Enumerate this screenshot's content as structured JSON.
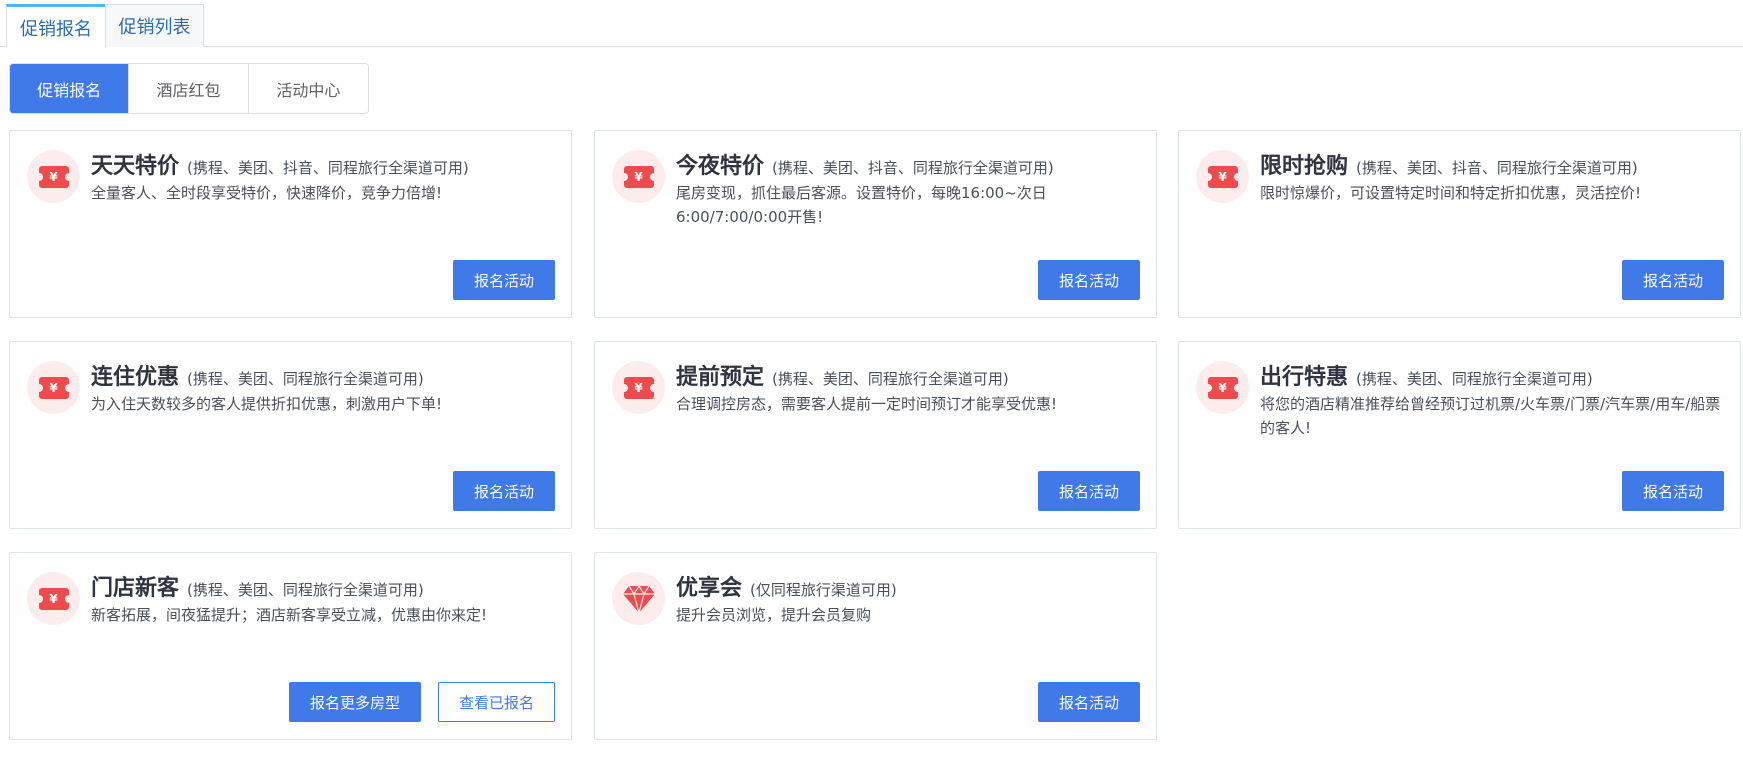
{
  "top_tabs": [
    "促销报名",
    "促销列表"
  ],
  "sub_tabs": [
    "促销报名",
    "酒店红包",
    "活动中心"
  ],
  "ticket_symbol": "¥",
  "cards": [
    {
      "title": "天天特价",
      "subtitle": "(携程、美团、抖音、同程旅行全渠道可用)",
      "desc": "全量客人、全时段享受特价，快速降价，竞争力倍增!",
      "button": "报名活动",
      "icon": "ticket-icon"
    },
    {
      "title": "今夜特价",
      "subtitle": "(携程、美团、抖音、同程旅行全渠道可用)",
      "desc": "尾房变现，抓住最后客源。设置特价，每晚16:00~次日6:00/7:00/0:00开售!",
      "button": "报名活动",
      "icon": "ticket-icon"
    },
    {
      "title": "限时抢购",
      "subtitle": "(携程、美团、抖音、同程旅行全渠道可用)",
      "desc": "限时惊爆价，可设置特定时间和特定折扣优惠，灵活控价!",
      "button": "报名活动",
      "icon": "ticket-icon"
    },
    {
      "title": "连住优惠",
      "subtitle": "(携程、美团、同程旅行全渠道可用)",
      "desc": "为入住天数较多的客人提供折扣优惠，刺激用户下单!",
      "button": "报名活动",
      "icon": "ticket-icon"
    },
    {
      "title": "提前预定",
      "subtitle": "(携程、美团、同程旅行全渠道可用)",
      "desc": "合理调控房态，需要客人提前一定时间预订才能享受优惠!",
      "button": "报名活动",
      "icon": "ticket-icon"
    },
    {
      "title": "出行特惠",
      "subtitle": "(携程、美团、同程旅行全渠道可用)",
      "desc": "将您的酒店精准推荐给曾经预订过机票/火车票/门票/汽车票/用车/船票的客人!",
      "button": "报名活动",
      "icon": "ticket-icon"
    },
    {
      "title": "门店新客",
      "subtitle": "(携程、美团、同程旅行全渠道可用)",
      "desc": "新客拓展，间夜猛提升；酒店新客享受立减，优惠由你来定!",
      "button": "报名更多房型",
      "button_secondary": "查看已报名",
      "icon": "ticket-icon"
    },
    {
      "title": "优享会",
      "subtitle": "(仅同程旅行渠道可用)",
      "desc": "提升会员浏览，提升会员复购",
      "button": "报名活动",
      "icon": "diamond-icon"
    }
  ],
  "colors": {
    "primary": "#3f7ae8",
    "icon_red": "#ee4b4f",
    "icon_bg": "#fdecec",
    "tab_active_top": "#52b6ee"
  }
}
